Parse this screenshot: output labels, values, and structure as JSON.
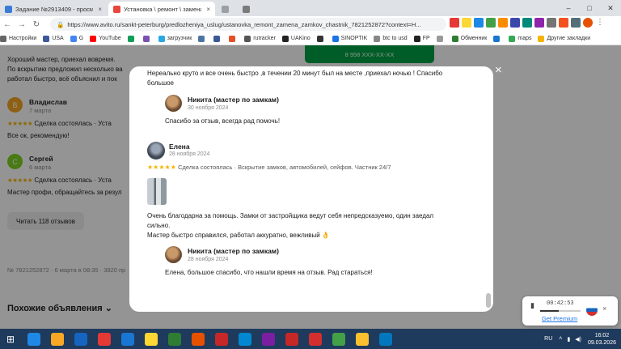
{
  "browser": {
    "tabs": [
      {
        "label": "Задание №2913409 - просмотр з",
        "favicon_color": "#3a7bd5",
        "active": false
      },
      {
        "label": "Установка \\ ремонт \\ замена зам",
        "favicon_color": "#e9463d",
        "active": true
      },
      {
        "label": "",
        "favicon_color": "#9aa0a6",
        "active": false
      },
      {
        "label": "",
        "favicon_color": "#7b7b7b",
        "active": false
      }
    ],
    "url": "https://www.avito.ru/sankt-peterburg/predlozheniya_uslug/ustanovka_remont_zamena_zamkov_chastnik_7821252872?context=H...",
    "bookmarks": [
      {
        "label": "Настройки",
        "color": "#666"
      },
      {
        "label": "USA",
        "color": "#3b5998"
      },
      {
        "label": "G",
        "color": "#4285f4"
      },
      {
        "label": "YouTube",
        "color": "#ff0000"
      },
      {
        "label": "",
        "color": "#0f9d58"
      },
      {
        "label": "",
        "color": "#7952b3"
      },
      {
        "label": "загрузчик",
        "color": "#29a9e1"
      },
      {
        "label": "",
        "color": "#4c75a3"
      },
      {
        "label": "",
        "color": "#3b5998"
      },
      {
        "label": "",
        "color": "#e34f26"
      },
      {
        "label": "rutracker",
        "color": "#555"
      },
      {
        "label": "UAKino",
        "color": "#222"
      },
      {
        "label": "",
        "color": "#333"
      },
      {
        "label": "SINOPTIK",
        "color": "#1a73e8"
      },
      {
        "label": "btc to usd",
        "color": "#888"
      },
      {
        "label": "FP",
        "color": "#222"
      },
      {
        "label": "",
        "color": "#999"
      },
      {
        "label": "Обменник",
        "color": "#2e7d32"
      },
      {
        "label": "",
        "color": "#1976d2"
      },
      {
        "label": "maps",
        "color": "#34a853"
      },
      {
        "label": "Другие закладки",
        "color": "#f4b400"
      }
    ]
  },
  "background_page": {
    "green_button_text": "8 958 XXX-XX-XX",
    "reviews": [
      {
        "text1": "Хороший мастер, приехал вовремя.",
        "text2": "По вскрытию предложил несколько ва",
        "text3": "работал быстро, всё объяснил и пок"
      },
      {
        "initial": "В",
        "avatar_color": "#f5a623",
        "name": "Владислав",
        "date": "7 марта",
        "status": "Сделка состоялась · Уста",
        "text": "Все ок, рекомендую!"
      },
      {
        "initial": "С",
        "avatar_color": "#7ed321",
        "name": "Сергей",
        "date": "6 марта",
        "status": "Сделка состоялась · Уста",
        "text": "Мастер профи, обращайтесь за резул"
      }
    ],
    "more_button": "Читать 118 отзывов",
    "ad_meta": "№ 7821252872 · 6 марта в 08:35 · 3820 пр",
    "similar_heading": "Похожие объявления ⌄"
  },
  "modal": {
    "top_text_1": "Нереально круто и все очень быстро ,в течении 20 минут был на месте ,приехал ночью ! Спасибо",
    "top_text_2": "большое",
    "reply1": {
      "name": "Никита (мастер по замкам)",
      "date": "30 ноября 2024",
      "text": "Спасибо за отзыв, всегда рад помочь!"
    },
    "review": {
      "name": "Елена",
      "date": "28 ноября 2024",
      "stars": "★★★★★",
      "meta": "Сделка состоялась · Вскрытие замков, автомобилей, сейфов. Частник 24/7",
      "text_1": "Очень благодарна за помощь. Замки от застройщика ведут себя непредсказуемо, один заедал",
      "text_2": "сильно.",
      "text_3": "Мастер быстро справился, работал аккуратно, вежливый 👌"
    },
    "reply2": {
      "name": "Никита (мастер по замкам)",
      "date": "28 ноября 2024",
      "text": "Елена, большое спасибо, что нашли время на отзыв. Рад стараться!"
    },
    "close_icon": "×"
  },
  "player": {
    "time": "00:42:53",
    "cta": "Get Premium"
  },
  "taskbar": {
    "apps": [
      "#1e88e5",
      "#f9a825",
      "#1565c0",
      "#e53935",
      "#1976d2",
      "#fdd835",
      "#2e7d32",
      "#e65100",
      "#c62828",
      "#0288d1",
      "#7b1fa2",
      "#c62828",
      "#d32f2f",
      "#43a047",
      "#fbc02d",
      "#0277bd"
    ],
    "lang": "RU",
    "time": "16:02",
    "date": "09.03.2026"
  }
}
